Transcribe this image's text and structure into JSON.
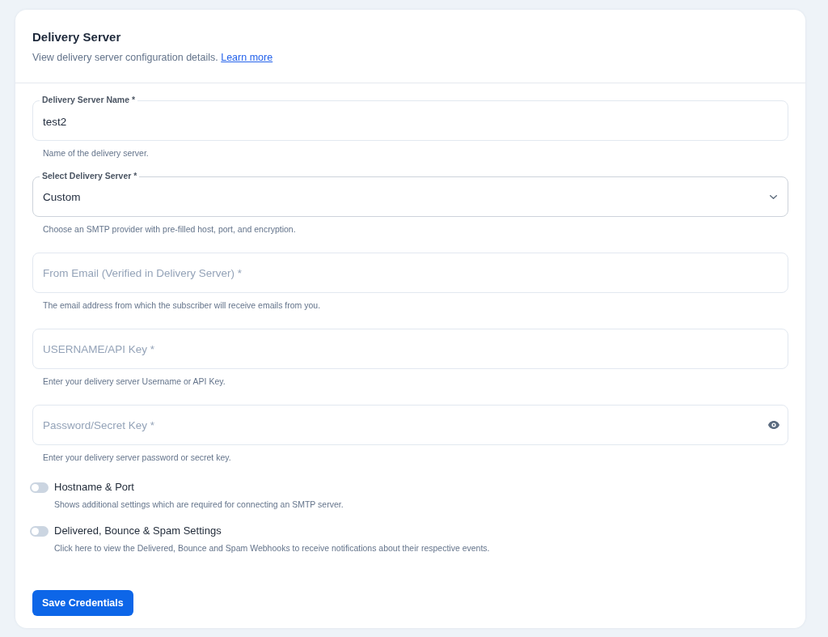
{
  "header": {
    "title": "Delivery Server",
    "description": "View delivery server configuration details.",
    "link": "Learn more"
  },
  "fields": [
    {
      "kind": "text",
      "label": "Delivery Server Name *",
      "value": "test2",
      "helper": "Name of the delivery server."
    },
    {
      "kind": "select",
      "label": "Select Delivery Server *",
      "value": "Custom",
      "helper": "Choose an SMTP provider with pre-filled host, port, and encryption."
    },
    {
      "kind": "text",
      "placeholder": "From Email (Verified in Delivery Server) *",
      "helper": "The email address from which the subscriber will receive emails from you."
    },
    {
      "kind": "text",
      "placeholder": "USERNAME/API Key *",
      "helper": "Enter your delivery server Username or API Key."
    },
    {
      "kind": "password",
      "placeholder": "Password/Secret Key *",
      "helper": "Enter your delivery server password or secret key."
    }
  ],
  "toggles": [
    {
      "label": "Hostname & Port",
      "description": "Shows additional settings which are required for connecting an SMTP server.",
      "on": false
    },
    {
      "label": "Delivered, Bounce & Spam Settings",
      "description": "Click here to view the Delivered, Bounce and Spam Webhooks to receive notifications about their respective events.",
      "on": false
    }
  ],
  "button": "Save Credentials"
}
